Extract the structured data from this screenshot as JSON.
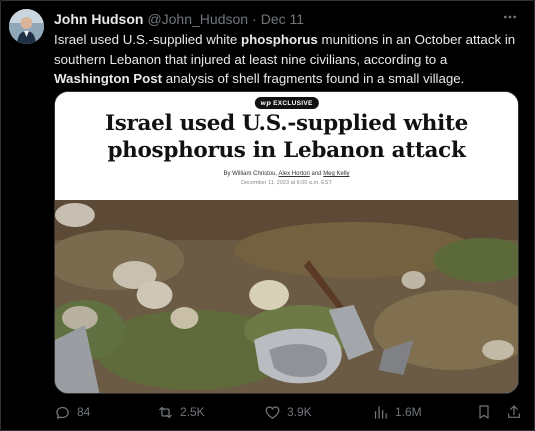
{
  "author": {
    "display_name": "John Hudson",
    "handle": "@John_Hudson",
    "separator": "·",
    "date": "Dec 11"
  },
  "tweet": {
    "segments": [
      {
        "text": "Israel used U.S.-supplied white ",
        "bold": false
      },
      {
        "text": "phosphorus",
        "bold": true
      },
      {
        "text": " munitions in an October attack in southern Lebanon that injured at least nine civilians, according to a ",
        "bold": false
      },
      {
        "text": "Washington Post",
        "bold": true
      },
      {
        "text": " analysis of shell fragments found in a small village.",
        "bold": false
      }
    ]
  },
  "card": {
    "badge_logo": "wp",
    "badge_label": "EXCLUSIVE",
    "headline_line1": "Israel used U.S.-supplied white",
    "headline_line2": "phosphorus in Lebanon attack",
    "byline_prefix": "By William Christou, ",
    "byline_author2": "Alex Horton",
    "byline_and": " and ",
    "byline_author3": "Meg Kelly",
    "pubdate": "December 11, 2023 at 6:00 a.m. EST"
  },
  "actions": {
    "replies": "84",
    "reposts": "2.5K",
    "likes": "3.9K",
    "views": "1.6M"
  },
  "icons": {
    "more": "more-horizontal-icon",
    "reply": "reply-icon",
    "repost": "repost-icon",
    "like": "heart-icon",
    "views": "views-chart-icon",
    "bookmark": "bookmark-icon",
    "share": "share-icon"
  },
  "colors": {
    "background": "#000000",
    "text": "#e7e9ea",
    "muted": "#71767b",
    "border": "#2f3336"
  }
}
